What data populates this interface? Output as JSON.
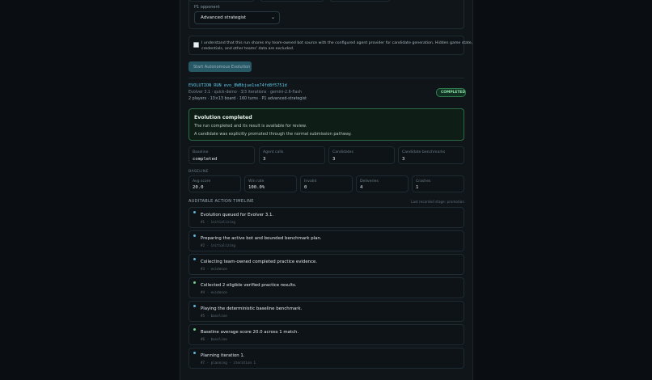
{
  "config": {
    "p1_opponent_label": "P1 opponent",
    "p1_opponent_value": "Advanced strategist",
    "consent_text_1": "I understand that this run shares my team-owned bot source with the configured agent provider for candidate generation. Hidden game state,",
    "consent_text_2": "credentials, and other teams' data are excluded.",
    "start_button": "Start Autonomous Evolution"
  },
  "run": {
    "id": "EVOLUTION RUN evo_8W8bjue1se74fd8f5751d",
    "line1": "Evolver 3.1 · quick-demo · 3/3 iterations · gemini-2.6-flash",
    "line2": "2 players · 13×13 board · 160 turns · P1 advanced-strategist",
    "status": "COMPLETED",
    "status_color": "#3fb068"
  },
  "alert": {
    "title": "Evolution completed",
    "line1": "The run completed and its result is available for review.",
    "line2": "A candidate was explicitly promoted through the normal submission pathway."
  },
  "summary": [
    {
      "label": "Baseline",
      "value": "completed"
    },
    {
      "label": "Agent calls",
      "value": "3"
    },
    {
      "label": "Candidates",
      "value": "3"
    },
    {
      "label": "Candidate benchmarks",
      "value": "3"
    }
  ],
  "baseline": {
    "heading": "BASELINE",
    "stats": [
      {
        "label": "Avg score",
        "value": "20.0"
      },
      {
        "label": "Win rate",
        "value": "100.0%"
      },
      {
        "label": "Invalid",
        "value": "0"
      },
      {
        "label": "Deliveries",
        "value": "4"
      },
      {
        "label": "Crashes",
        "value": "1"
      }
    ]
  },
  "timeline": {
    "heading": "AUDITABLE ACTION TIMELINE",
    "note": "Last recorded stage: promotion",
    "events": [
      {
        "title": "Evolution queued for Evolver 3.1.",
        "meta": "#1 · initializing",
        "color": "blue"
      },
      {
        "title": "Preparing the active bot and bounded benchmark plan.",
        "meta": "#2 · initializing",
        "color": "blue"
      },
      {
        "title": "Collecting team-owned completed practice evidence.",
        "meta": "#3 · evidence",
        "color": "blue"
      },
      {
        "title": "Collected 2 eligible verified practice results.",
        "meta": "#4 · evidence",
        "color": "green"
      },
      {
        "title": "Playing the deterministic baseline benchmark.",
        "meta": "#5 · baseline",
        "color": "blue"
      },
      {
        "title": "Baseline average score 20.0 across 1 match.",
        "meta": "#6 · baseline",
        "color": "green"
      },
      {
        "title": "Planning iteration 1.",
        "meta": "#7 · planning · iteration 1",
        "color": "blue"
      }
    ]
  }
}
